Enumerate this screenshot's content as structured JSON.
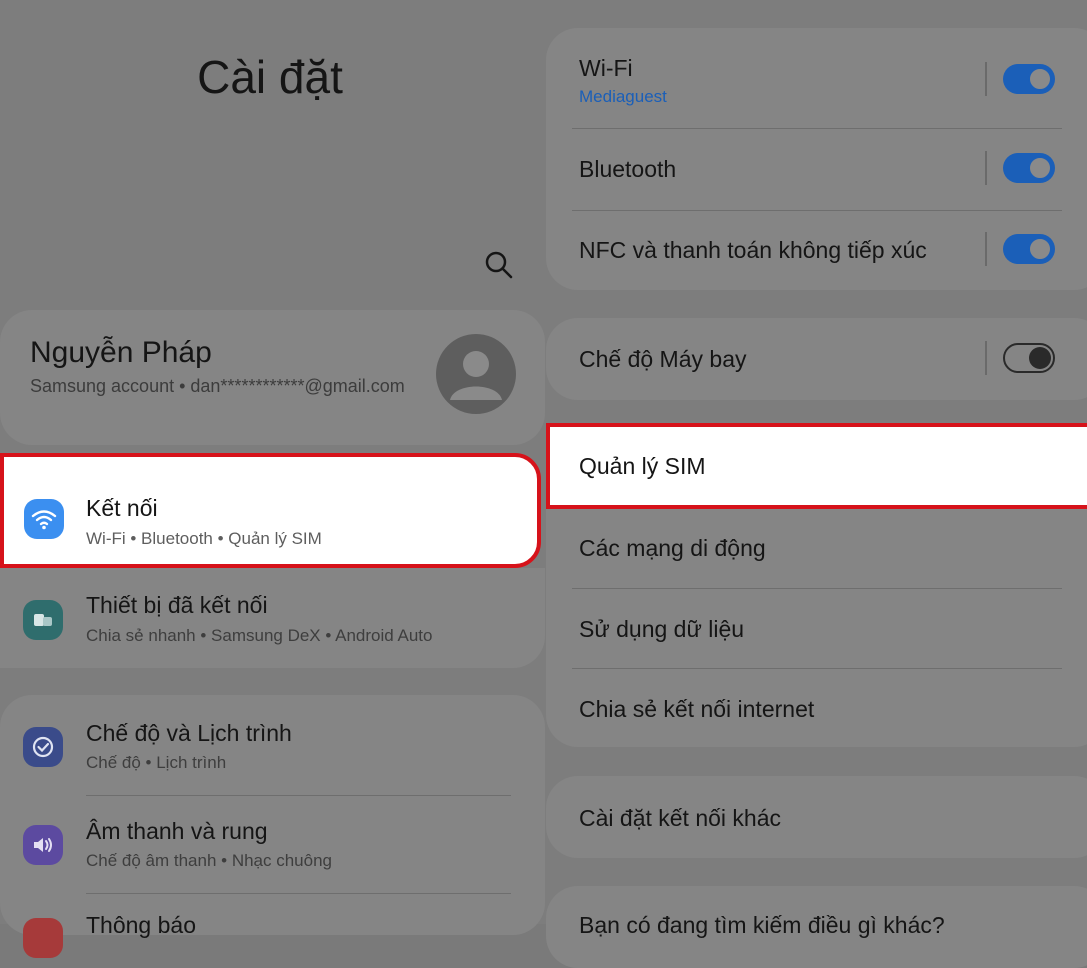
{
  "page_title": "Cài đặt",
  "profile": {
    "name": "Nguyễn Pháp",
    "account": "Samsung account  •  dan************@gmail.com"
  },
  "left_items": [
    {
      "title": "Kết nối",
      "subtitle": "Wi-Fi  •  Bluetooth  •  Quản lý SIM",
      "icon": "wifi-icon",
      "color": "#3b8ff0"
    },
    {
      "title": "Thiết bị đã kết nối",
      "subtitle": "Chia sẻ nhanh  •  Samsung DeX  •  Android Auto",
      "icon": "devices-icon",
      "color": "#2f6d6d"
    },
    {
      "title": "Chế độ và Lịch trình",
      "subtitle": "Chế độ  •  Lịch trình",
      "icon": "modes-icon",
      "color": "#3a4b8a"
    },
    {
      "title": "Âm thanh và rung",
      "subtitle": "Chế độ âm thanh  •  Nhạc chuông",
      "icon": "sound-icon",
      "color": "#5c4aa0"
    },
    {
      "title": "Thông báo",
      "icon": "notification-icon",
      "color": "#a63a3a"
    }
  ],
  "right": {
    "wifi": {
      "label": "Wi-Fi",
      "network": "Mediaguest",
      "on": true
    },
    "bluetooth": {
      "label": "Bluetooth",
      "on": true
    },
    "nfc": {
      "label": "NFC và thanh toán không tiếp xúc",
      "on": true
    },
    "airplane": {
      "label": "Chế độ Máy bay",
      "on": false
    },
    "sim": "Quản lý SIM",
    "mobile_networks": "Các mạng di động",
    "data_usage": "Sử dụng dữ liệu",
    "hotspot": "Chia sẻ kết nối internet",
    "more_settings": "Cài đặt kết nối khác",
    "bottom_partial": "Bạn có đang tìm kiếm điều gì khác?"
  },
  "colors": {
    "highlight": "#d6121a",
    "toggle_on": "#1b5fb8",
    "link": "#1b5fb8"
  }
}
